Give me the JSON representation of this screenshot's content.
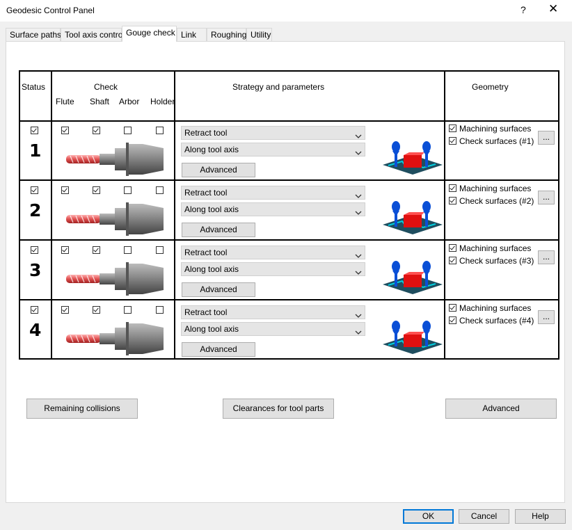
{
  "window": {
    "title": "Geodesic Control Panel",
    "help_glyph": "?",
    "close_glyph": "✕"
  },
  "tabs": [
    {
      "label": "Surface paths"
    },
    {
      "label": "Tool axis control"
    },
    {
      "label": "Gouge check"
    },
    {
      "label": "Link"
    },
    {
      "label": "Roughing"
    },
    {
      "label": "Utility"
    }
  ],
  "active_tab": "Gouge check",
  "table": {
    "headers": {
      "status": "Status",
      "check": "Check",
      "flute": "Flute",
      "shaft": "Shaft",
      "arbor": "Arbor",
      "holder": "Holder",
      "strategy": "Strategy and parameters",
      "geometry": "Geometry"
    },
    "rows": [
      {
        "number": "1",
        "status": true,
        "flute": true,
        "shaft": true,
        "arbor": false,
        "holder": false,
        "strategy": "Retract tool",
        "direction": "Along tool axis",
        "advanced_label": "Advanced",
        "machining_label": "Machining surfaces",
        "machining": true,
        "check_label": "Check surfaces (#1)",
        "check": true,
        "more_label": "..."
      },
      {
        "number": "2",
        "status": true,
        "flute": true,
        "shaft": true,
        "arbor": false,
        "holder": false,
        "strategy": "Retract tool",
        "direction": "Along tool axis",
        "advanced_label": "Advanced",
        "machining_label": "Machining surfaces",
        "machining": true,
        "check_label": "Check surfaces (#2)",
        "check": true,
        "more_label": "..."
      },
      {
        "number": "3",
        "status": true,
        "flute": true,
        "shaft": true,
        "arbor": false,
        "holder": false,
        "strategy": "Retract tool",
        "direction": "Along tool axis",
        "advanced_label": "Advanced",
        "machining_label": "Machining surfaces",
        "machining": true,
        "check_label": "Check surfaces (#3)",
        "check": true,
        "more_label": "..."
      },
      {
        "number": "4",
        "status": true,
        "flute": true,
        "shaft": true,
        "arbor": false,
        "holder": false,
        "strategy": "Retract tool",
        "direction": "Along tool axis",
        "advanced_label": "Advanced",
        "machining_label": "Machining surfaces",
        "machining": true,
        "check_label": "Check surfaces (#4)",
        "check": true,
        "more_label": "..."
      }
    ]
  },
  "actions": {
    "remaining_collisions": "Remaining collisions",
    "clearances": "Clearances for tool parts",
    "advanced": "Advanced"
  },
  "footer": {
    "ok": "OK",
    "cancel": "Cancel",
    "help": "Help"
  },
  "colors": {
    "accent": "#0078d7",
    "tool_flute": "#e05050",
    "strategy_icon_blue": "#0a4fd6",
    "strategy_icon_red": "#e01010",
    "strategy_icon_base": "#1f4e5f"
  }
}
